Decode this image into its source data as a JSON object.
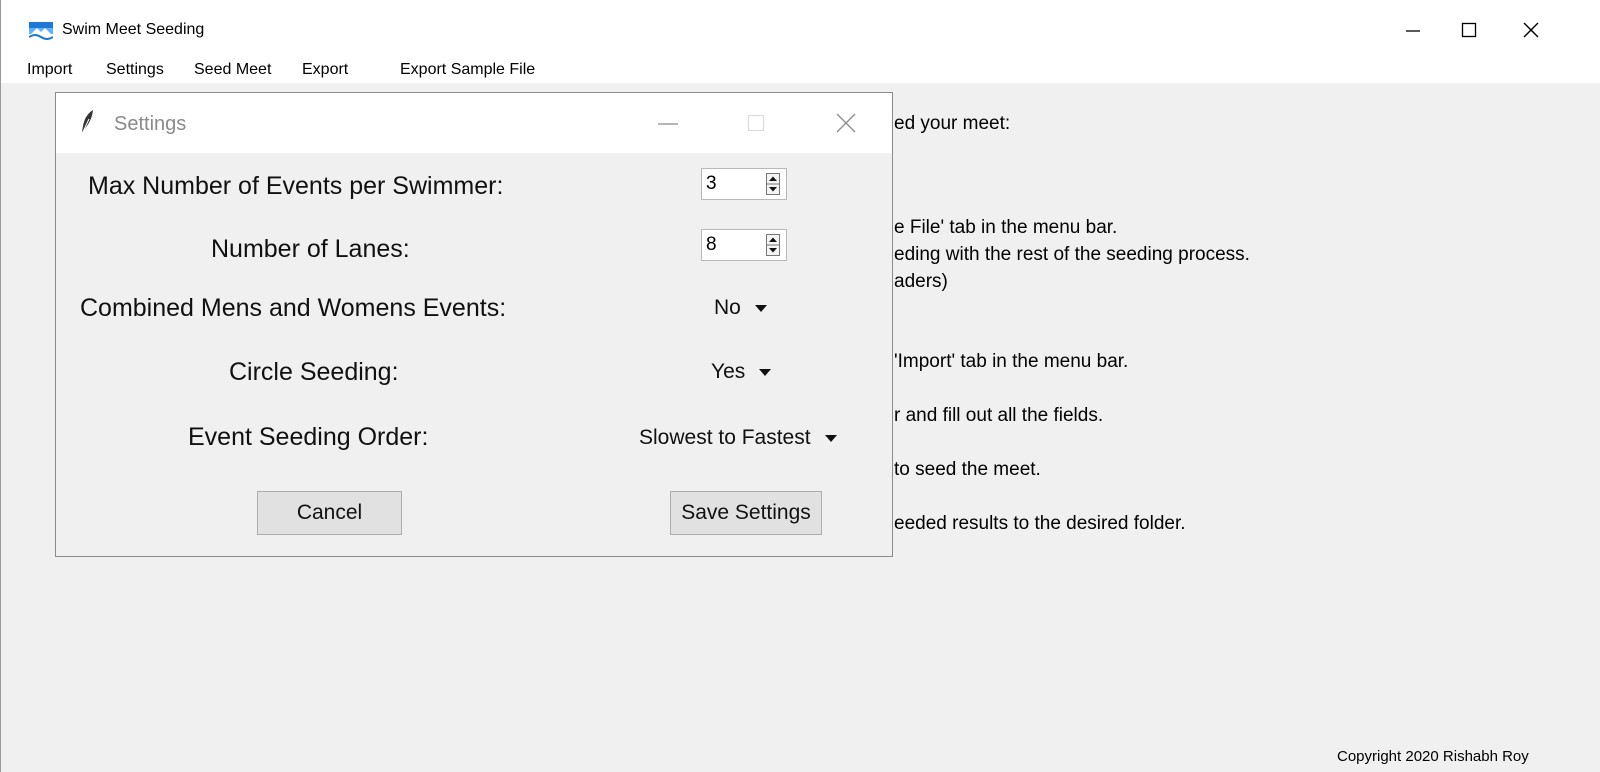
{
  "window": {
    "title": "Swim Meet Seeding",
    "icon": "swimmer-icon"
  },
  "menu": {
    "items": [
      "Import",
      "Settings",
      "Seed Meet",
      "Export",
      "Export Sample File"
    ]
  },
  "instructions": [
    "ed your meet:",
    "e File' tab in the menu bar.",
    "eding with the rest of the seeding process.",
    "aders)",
    "'Import' tab in the menu bar.",
    "r and fill out all the fields.",
    "to seed the meet.",
    "eeded results to the desired folder."
  ],
  "copyright": "Copyright 2020 Rishabh Roy",
  "dialog": {
    "title": "Settings",
    "icon": "feather-icon",
    "max_events": {
      "label": "Max Number of Events per Swimmer:",
      "value": "3"
    },
    "lanes": {
      "label": "Number of Lanes:",
      "value": "8"
    },
    "combined": {
      "label": "Combined Mens and Womens Events:",
      "value": "No"
    },
    "circle": {
      "label": "Circle Seeding:",
      "value": "Yes"
    },
    "order": {
      "label": "Event Seeding Order:",
      "value": "Slowest to Fastest"
    },
    "cancel_label": "Cancel",
    "save_label": "Save Settings"
  }
}
